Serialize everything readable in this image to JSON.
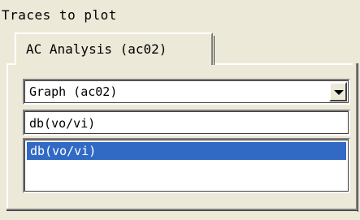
{
  "panel": {
    "title": "Traces to plot"
  },
  "tabs": [
    {
      "label": "AC Analysis (ac02)",
      "active": true
    }
  ],
  "graph_select": {
    "value": "Graph (ac02)",
    "icon": "chevron-down-icon"
  },
  "trace_field": {
    "value": "db(vo/vi)"
  },
  "trace_list": {
    "items": [
      {
        "label": "db(vo/vi)",
        "selected": true
      }
    ]
  },
  "colors": {
    "background": "#ece9d8",
    "selection": "#316ac5",
    "selection_text": "#ffffff"
  }
}
